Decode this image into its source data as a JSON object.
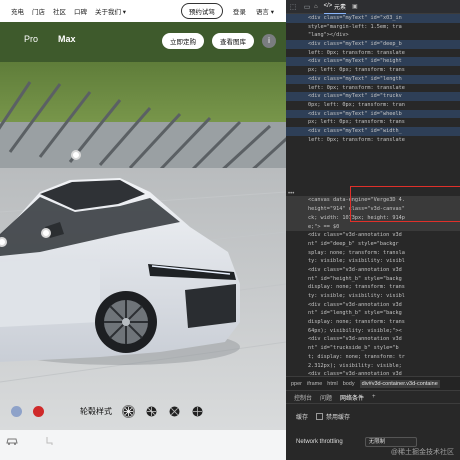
{
  "site_nav": {
    "items": [
      "充电",
      "门店",
      "社区",
      "口碑",
      "关于我们 ▾"
    ],
    "test_drive": "预约试驾",
    "login": "登录",
    "language": "语言 ▾"
  },
  "scene": {
    "model_tabs": [
      "Pro",
      "Max"
    ],
    "order_button": "立即定购",
    "gallery_button": "查看图库",
    "info_icon": "i"
  },
  "config": {
    "wheel_label": "轮毂样式",
    "colors": [
      "#8ea2c9",
      "#cf2a2a"
    ]
  },
  "devtools": {
    "tabs": [
      "",
      "元素",
      ""
    ],
    "dom_lines": [
      {
        "t": "<div class=\"myText\" id=\"x03_in",
        "k": ""
      },
      {
        "t": "style=\"margin-left: 1.5em; tra",
        "k": ""
      },
      {
        "t": "\"lang\"></div>",
        "k": ""
      },
      {
        "t": "<div class=\"myText\" id=\"deep_b",
        "k": ""
      },
      {
        "t": "left: 0px; transform: translate",
        "k": ""
      },
      {
        "t": "<div class=\"myText\" id=\"height",
        "k": ""
      },
      {
        "t": "px; left: 0px; transform: trans",
        "k": ""
      },
      {
        "t": "<div class=\"myText\" id=\"length",
        "k": ""
      },
      {
        "t": "left: 0px; transform: translate",
        "k": ""
      },
      {
        "t": "<div class=\"myText\" id=\"truckv",
        "k": ""
      },
      {
        "t": "0px; left: 0px; transform: tran",
        "k": ""
      },
      {
        "t": "<div class=\"myText\" id=\"wheelb",
        "k": ""
      },
      {
        "t": "px; left: 0px; transform: trans",
        "k": ""
      },
      {
        "t": "<div class=\"myText\" id=\"width_",
        "k": ""
      },
      {
        "t": "left: 0px; transform: translate",
        "k": ""
      },
      {
        "t": "",
        "k": ""
      },
      {
        "t": "",
        "k": ""
      },
      {
        "t": "",
        "k": ""
      },
      {
        "t": "",
        "k": ""
      },
      {
        "t": "",
        "k": ""
      },
      {
        "t": "",
        "k": ""
      },
      {
        "t": "<canvas data-engine=\"Verge3D 4.",
        "k": "sel"
      },
      {
        "t": "height=\"914\" class=\"v3d-canvas\"",
        "k": "sel"
      },
      {
        "t": "ck; width: 1073px; height: 914p",
        "k": "sel"
      },
      {
        "t": "e;\"> == $0",
        "k": "sel"
      },
      {
        "t": "<div class=\"v3d-annotation v3d",
        "k": ""
      },
      {
        "t": "nt\" id=\"deep_b\" style=\"backgr",
        "k": ""
      },
      {
        "t": "splay: none; transform: transla",
        "k": ""
      },
      {
        "t": "ty: visible; visibility: visibl",
        "k": ""
      },
      {
        "t": "<div class=\"v3d-annotation v3d",
        "k": ""
      },
      {
        "t": "nt\" id=\"height_b\" style=\"backg",
        "k": ""
      },
      {
        "t": "display: none; transform: trans",
        "k": ""
      },
      {
        "t": "ty: visible; visibility: visibl",
        "k": ""
      },
      {
        "t": "<div class=\"v3d-annotation v3d",
        "k": ""
      },
      {
        "t": "nt\" id=\"length_b\" style=\"backg",
        "k": ""
      },
      {
        "t": "display: none; transform: trans",
        "k": ""
      },
      {
        "t": "64px); visibility: visible;\"><",
        "k": ""
      },
      {
        "t": "<div class=\"v3d-annotation v3d",
        "k": ""
      },
      {
        "t": "nt\" id=\"truckside_b\" style=\"b",
        "k": ""
      },
      {
        "t": "t; display: none; transform: tr",
        "k": ""
      },
      {
        "t": "2.312px); visibility: visible;",
        "k": ""
      },
      {
        "t": "<div class=\"v3d-annotation v3d",
        "k": ""
      }
    ],
    "breadcrumb": [
      "pper",
      "iframe",
      "html",
      "body",
      "div#v3d-container.v3d-containe"
    ],
    "drawer_tabs": [
      "控制台",
      "问题",
      "网络条件"
    ],
    "cache_label": "缓存",
    "disable_cache": "禁用缓存",
    "throttling_label": "Network throttling",
    "throttling_value": "无限制",
    "watermark": "@稀土掘金技术社区"
  }
}
